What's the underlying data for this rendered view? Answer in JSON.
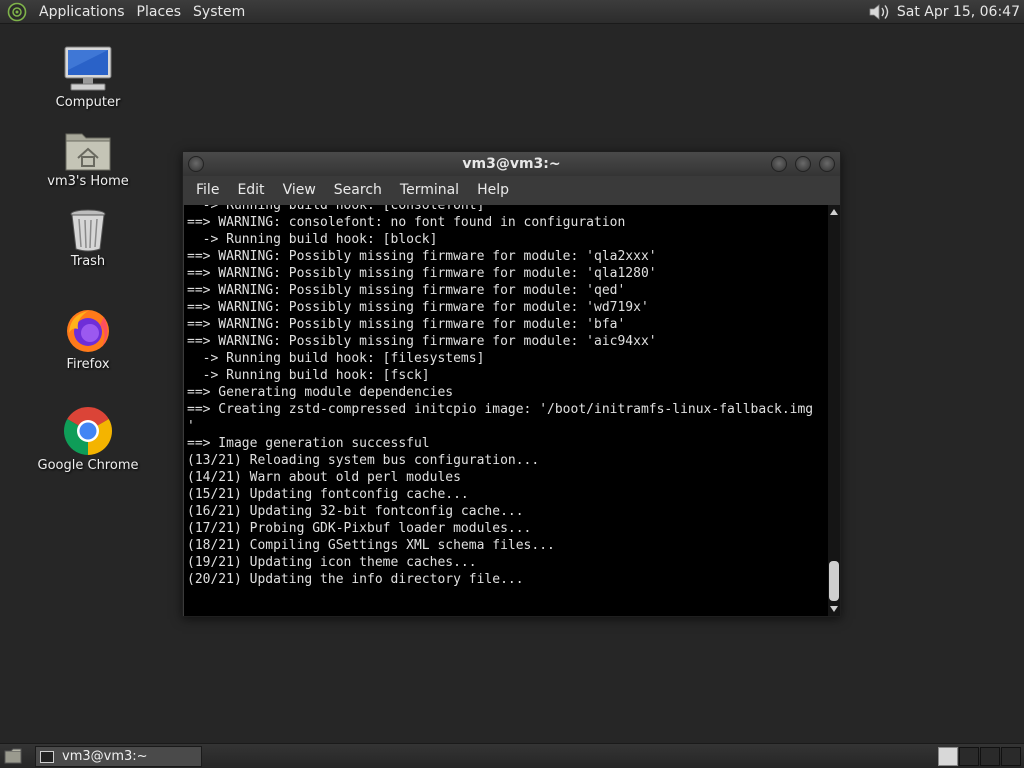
{
  "top_panel": {
    "menus": [
      "Applications",
      "Places",
      "System"
    ],
    "clock": "Sat Apr 15, 06:47",
    "icons": [
      "distro-logo-icon",
      "volume-icon"
    ]
  },
  "desktop": {
    "icons": [
      {
        "label": "Computer",
        "icon": "computer-icon"
      },
      {
        "label": "vm3's Home",
        "icon": "home-folder-icon"
      },
      {
        "label": "Trash",
        "icon": "trash-icon"
      },
      {
        "label": "Firefox",
        "icon": "firefox-icon"
      },
      {
        "label": "Google Chrome",
        "icon": "chrome-icon"
      }
    ]
  },
  "terminal": {
    "title": "vm3@vm3:~",
    "menu": [
      "File",
      "Edit",
      "View",
      "Search",
      "Terminal",
      "Help"
    ],
    "lines": [
      "  -> Running build hook: [consolefont]",
      "==> WARNING: consolefont: no font found in configuration",
      "  -> Running build hook: [block]",
      "==> WARNING: Possibly missing firmware for module: 'qla2xxx'",
      "==> WARNING: Possibly missing firmware for module: 'qla1280'",
      "==> WARNING: Possibly missing firmware for module: 'qed'",
      "==> WARNING: Possibly missing firmware for module: 'wd719x'",
      "==> WARNING: Possibly missing firmware for module: 'bfa'",
      "==> WARNING: Possibly missing firmware for module: 'aic94xx'",
      "  -> Running build hook: [filesystems]",
      "  -> Running build hook: [fsck]",
      "==> Generating module dependencies",
      "==> Creating zstd-compressed initcpio image: '/boot/initramfs-linux-fallback.img",
      "'",
      "==> Image generation successful",
      "(13/21) Reloading system bus configuration...",
      "(14/21) Warn about old perl modules",
      "(15/21) Updating fontconfig cache...",
      "(16/21) Updating 32-bit fontconfig cache...",
      "(17/21) Probing GDK-Pixbuf loader modules...",
      "(18/21) Compiling GSettings XML schema files...",
      "(19/21) Updating icon theme caches...",
      "(20/21) Updating the info directory file..."
    ]
  },
  "taskbar": {
    "task_label": "vm3@vm3:~",
    "workspaces": 4
  }
}
